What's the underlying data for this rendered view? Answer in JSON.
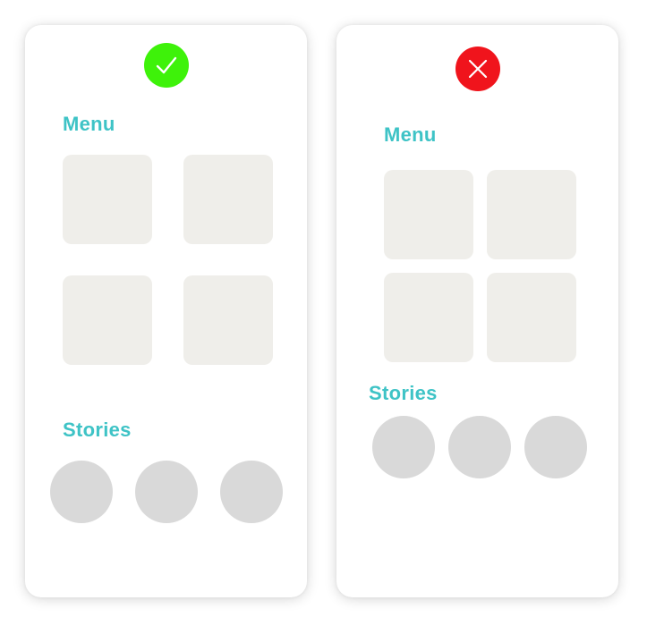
{
  "colors": {
    "good": "#3ef20a",
    "bad": "#f0141c",
    "title": "#3ec3c6",
    "tile": "#efeeea",
    "story": "#d9d9d9",
    "icon": "#ffffff"
  },
  "good_example": {
    "status_icon": "check-icon",
    "menu_title": "Menu",
    "stories_title": "Stories"
  },
  "bad_example": {
    "status_icon": "close-icon",
    "menu_title": "Menu",
    "stories_title": "Stories"
  }
}
